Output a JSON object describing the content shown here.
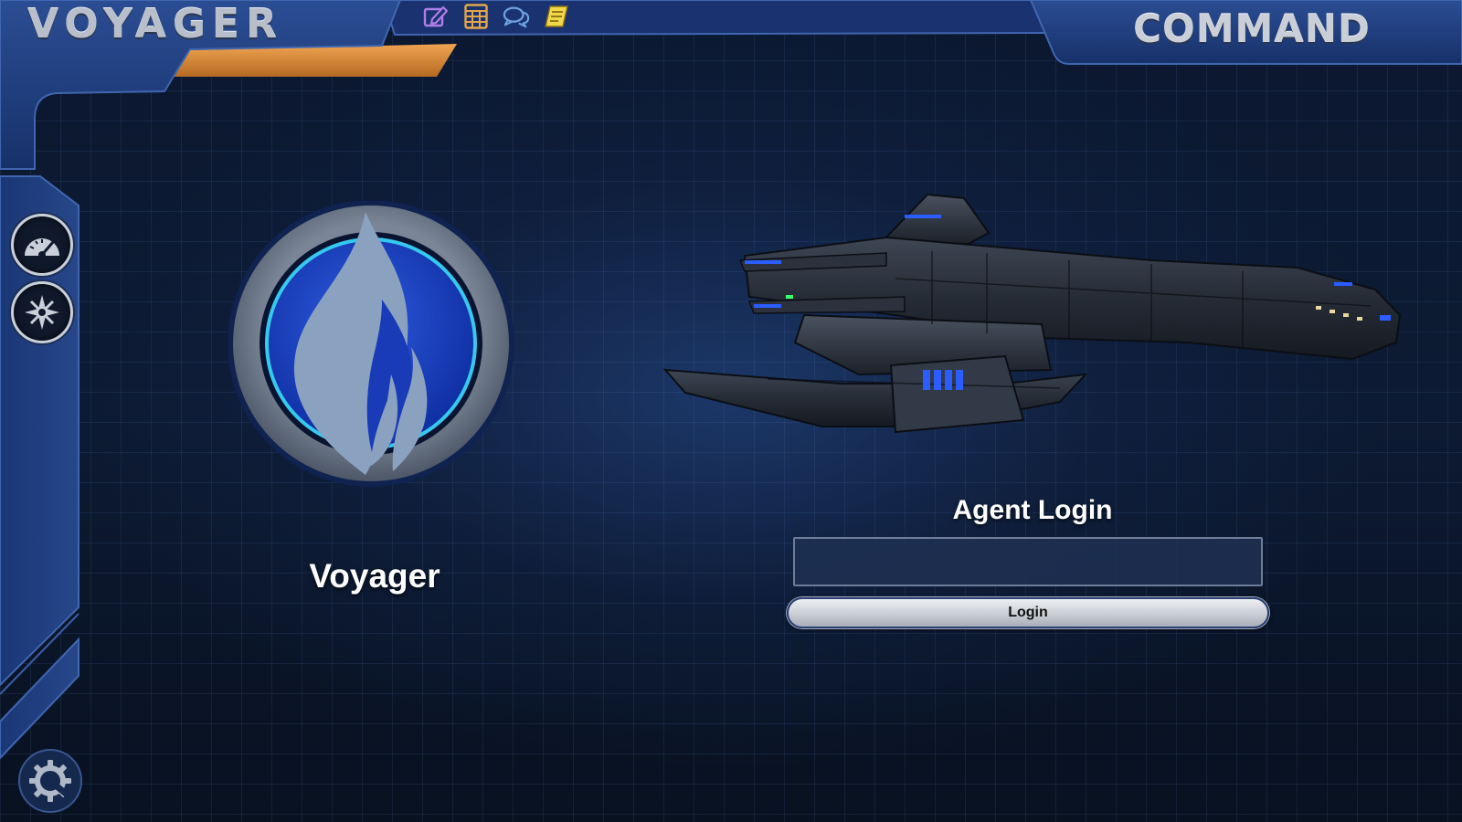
{
  "app": {
    "title": "VOYAGER",
    "section_title": "COMMAND"
  },
  "toolbar": {
    "items": [
      {
        "icon": "edit-icon",
        "color": "#b07ee8"
      },
      {
        "icon": "calculator-icon",
        "color": "#e3a64a"
      },
      {
        "icon": "chat-icon",
        "color": "#6ea2e0"
      },
      {
        "icon": "notes-icon",
        "color": "#f0d84a"
      }
    ]
  },
  "sidebar": {
    "items": [
      {
        "icon": "dashboard-gauge-icon"
      },
      {
        "icon": "navigation-compass-icon"
      }
    ],
    "footer_icon": "settings-gear-icon"
  },
  "ship": {
    "name": "Voyager",
    "emblem_icon": "flame-emblem-icon"
  },
  "login": {
    "title": "Agent Login",
    "input_value": "",
    "input_placeholder": "",
    "button_label": "Login"
  },
  "colors": {
    "frame_blue": "#1f3e7c",
    "frame_dark": "#0c1a38",
    "accent_orange": "#e0903c",
    "emblem_blue": "#1a3bb8",
    "emblem_ring": "#5d6d80"
  }
}
